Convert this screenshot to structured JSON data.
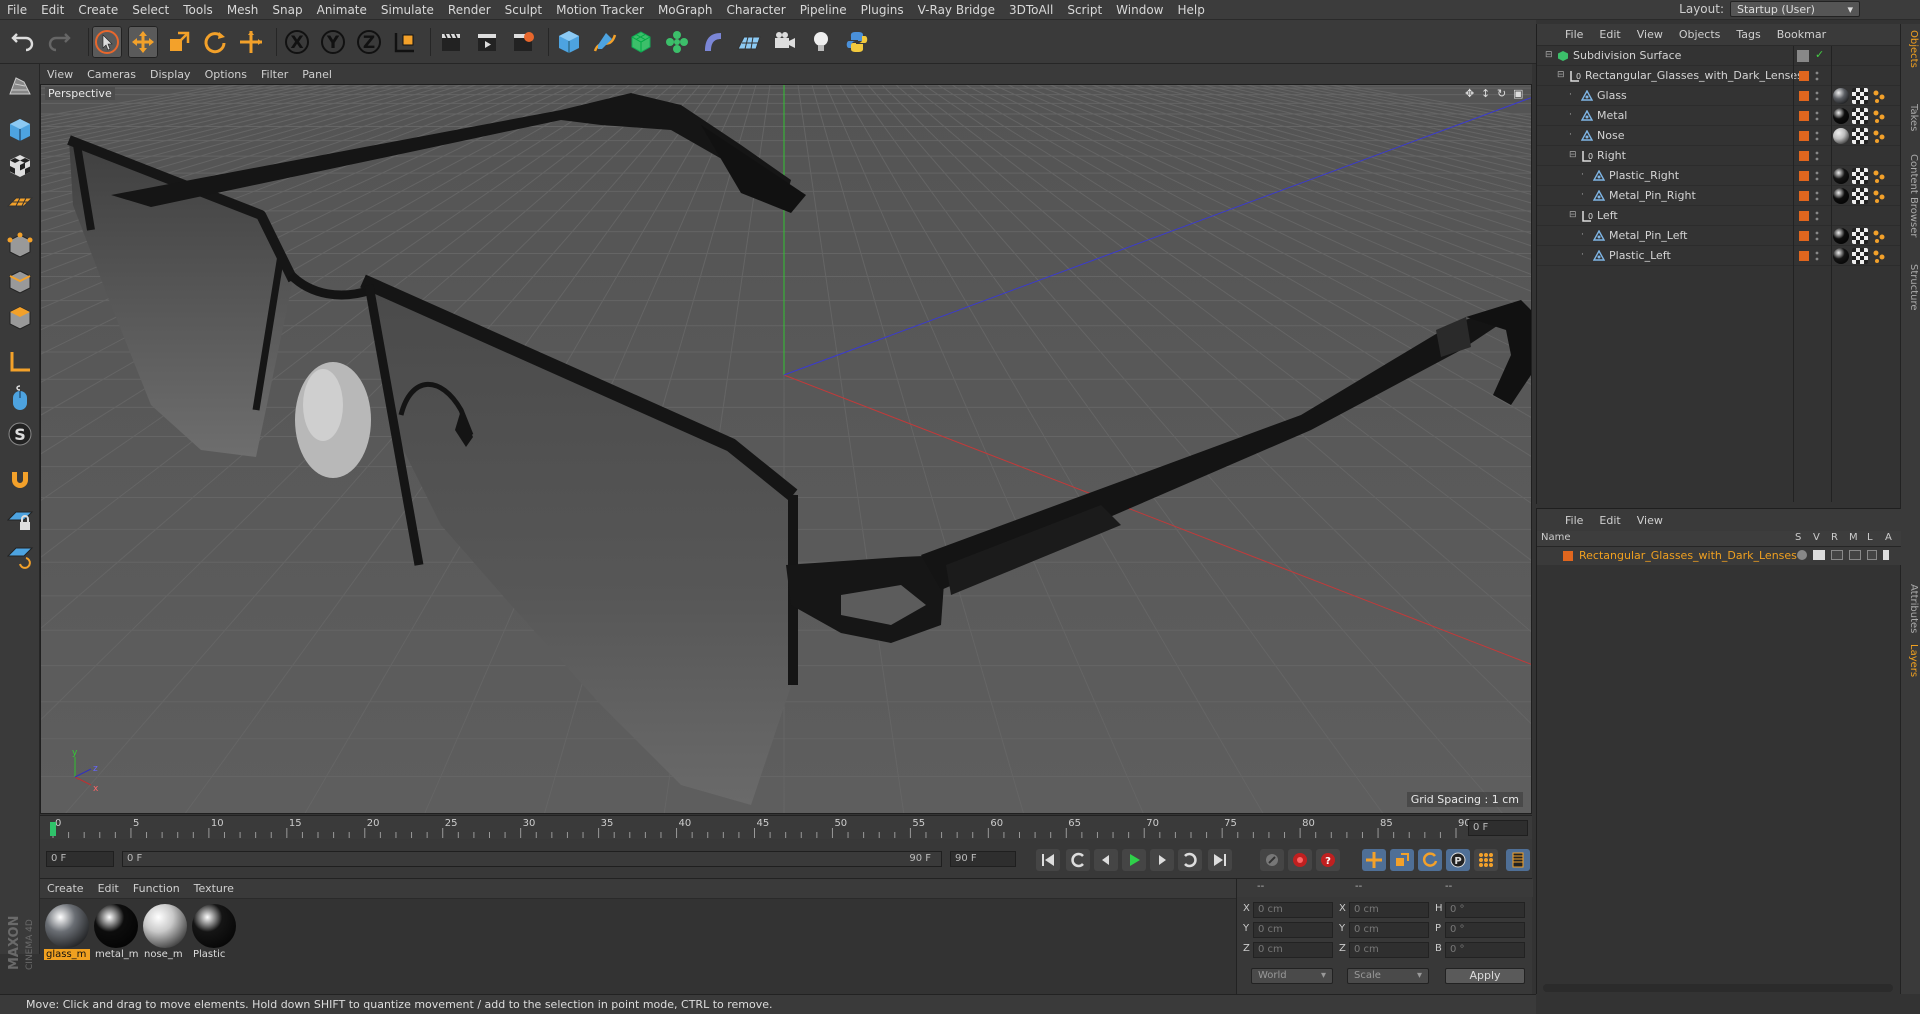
{
  "menubar": {
    "items": [
      "File",
      "Edit",
      "Create",
      "Select",
      "Tools",
      "Mesh",
      "Snap",
      "Animate",
      "Simulate",
      "Render",
      "Sculpt",
      "Motion Tracker",
      "MoGraph",
      "Character",
      "Pipeline",
      "Plugins",
      "V-Ray Bridge",
      "3DToAll",
      "Script",
      "Window",
      "Help"
    ],
    "layout_label": "Layout:",
    "layout_value": "Startup (User)"
  },
  "viewport": {
    "menu": [
      "View",
      "Cameras",
      "Display",
      "Options",
      "Filter",
      "Panel"
    ],
    "label": "Perspective",
    "grid_spacing": "Grid Spacing : 1 cm",
    "axis_labels": [
      "y",
      "z",
      "x"
    ]
  },
  "timeline": {
    "ticks": [
      "0",
      "5",
      "10",
      "15",
      "20",
      "25",
      "30",
      "35",
      "40",
      "45",
      "50",
      "55",
      "60",
      "65",
      "70",
      "75",
      "80",
      "85",
      "90"
    ],
    "current_frame": "0 F",
    "start_field": "0 F",
    "range_start": "0 F",
    "range_end": "90 F",
    "end_field": "90 F"
  },
  "materials": {
    "menu": [
      "Create",
      "Edit",
      "Function",
      "Texture"
    ],
    "items": [
      {
        "name": "glass_m",
        "selected": true,
        "color": "#6a6e74"
      },
      {
        "name": "metal_m",
        "selected": false,
        "color": "#0d0d0d"
      },
      {
        "name": "nose_m",
        "selected": false,
        "color": "#c9c9c9"
      },
      {
        "name": "Plastic",
        "selected": false,
        "color": "#151515"
      }
    ]
  },
  "coordinates": {
    "headers": [
      "--",
      "--",
      "--"
    ],
    "rows": [
      {
        "l1": "X",
        "v1": "0 cm",
        "l2": "X",
        "v2": "0 cm",
        "l3": "H",
        "v3": "0 °"
      },
      {
        "l1": "Y",
        "v1": "0 cm",
        "l2": "Y",
        "v2": "0 cm",
        "l3": "P",
        "v3": "0 °"
      },
      {
        "l1": "Z",
        "v1": "0 cm",
        "l2": "Z",
        "v2": "0 cm",
        "l3": "B",
        "v3": "0 °"
      }
    ],
    "space": "World",
    "mode": "Scale",
    "apply": "Apply"
  },
  "status": "Move: Click and drag to move elements. Hold down SHIFT to quantize movement / add to the selection in point mode, CTRL to remove.",
  "object_manager": {
    "menu": [
      "File",
      "Edit",
      "View",
      "Objects",
      "Tags",
      "Bookmar"
    ],
    "rows": [
      {
        "name": "Subdivision Surface",
        "indent": 0,
        "icon": "subdivision-icon"
      },
      {
        "name": "Rectangular_Glasses_with_Dark_Lenses",
        "indent": 1,
        "icon": "null-icon"
      },
      {
        "name": "Glass",
        "indent": 2,
        "icon": "polygon-icon",
        "tag": "#5a5d62"
      },
      {
        "name": "Metal",
        "indent": 2,
        "icon": "polygon-icon",
        "tag": "#0d0d0d"
      },
      {
        "name": "Nose",
        "indent": 2,
        "icon": "polygon-icon",
        "tag": "#bdbdbd"
      },
      {
        "name": "Right",
        "indent": 2,
        "icon": "null-icon"
      },
      {
        "name": "Plastic_Right",
        "indent": 3,
        "icon": "polygon-icon",
        "tag": "#151515"
      },
      {
        "name": "Metal_Pin_Right",
        "indent": 3,
        "icon": "polygon-icon",
        "tag": "#0d0d0d"
      },
      {
        "name": "Left",
        "indent": 2,
        "icon": "null-icon"
      },
      {
        "name": "Metal_Pin_Left",
        "indent": 3,
        "icon": "polygon-icon",
        "tag": "#0d0d0d"
      },
      {
        "name": "Plastic_Left",
        "indent": 3,
        "icon": "polygon-icon",
        "tag": "#151515"
      }
    ]
  },
  "side_tabs": [
    "Objects",
    "Takes",
    "Content Browser",
    "Structure",
    "Attributes",
    "Layers"
  ],
  "layer_manager": {
    "menu": [
      "File",
      "Edit",
      "View"
    ],
    "columns": [
      "Name",
      "S",
      "V",
      "R",
      "M",
      "L",
      "A"
    ],
    "rows": [
      {
        "name": "Rectangular_Glasses_with_Dark_Lenses"
      }
    ]
  },
  "brand": {
    "maxon": "MAXON",
    "cinema": "CINEMA 4D"
  },
  "colors": {
    "accent": "#f0a020",
    "object_color": "#e0661e",
    "x_axis": "#c03030",
    "y_axis": "#30c030",
    "z_axis": "#3030c0"
  }
}
